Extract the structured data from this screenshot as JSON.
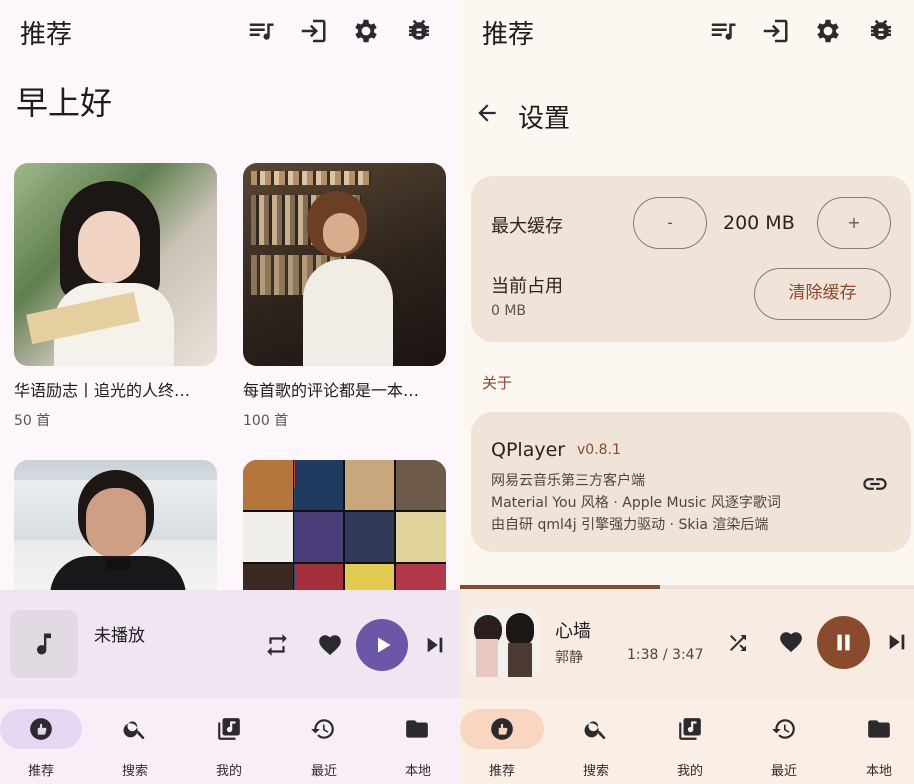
{
  "left": {
    "header": {
      "title": "推荐"
    },
    "greeting": "早上好",
    "cards": [
      {
        "title": "华语励志丨追光的人终…",
        "count": "50 首"
      },
      {
        "title": "每首歌的评论都是一本…",
        "count": "100 首"
      }
    ],
    "player": {
      "title": "未播放"
    },
    "nav": [
      "推荐",
      "搜索",
      "我的",
      "最近",
      "本地"
    ]
  },
  "right": {
    "header": {
      "title": "推荐"
    },
    "settings": {
      "title": "设置",
      "max_cache_label": "最大缓存",
      "minus": "-",
      "cache_value": "200 MB",
      "plus": "+",
      "current_usage_label": "当前占用",
      "current_usage_value": "0 MB",
      "clear_cache": "清除缓存",
      "about_label": "关于",
      "app_name": "QPlayer",
      "version": "v0.8.1",
      "desc": [
        "网易云音乐第三方客户端",
        "Material You 风格 · Apple Music 风逐字歌词",
        "由自研 qml4j 引擎强力驱动 · Skia 渲染后端"
      ]
    },
    "player": {
      "title": "心墙",
      "artist": "郭静",
      "time": "1:38 / 3:47",
      "progress": 0.44
    },
    "nav": [
      "推荐",
      "搜索",
      "我的",
      "最近",
      "本地"
    ]
  },
  "colors": {
    "left_accent": "#6b56a8",
    "right_accent": "#8a4a2c"
  }
}
